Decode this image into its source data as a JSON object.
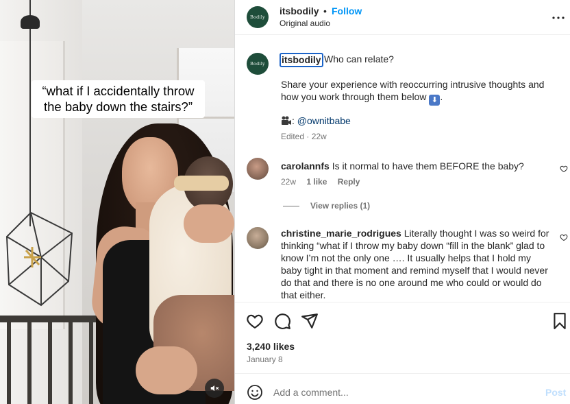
{
  "video": {
    "overlay_caption_line1": "“what if I accidentally throw",
    "overlay_caption_line2": "the baby down the stairs?”",
    "mute_icon": "speaker-muted-icon"
  },
  "header": {
    "avatar_text": "Bodily",
    "username": "itsbodily",
    "dot": "•",
    "follow_label": "Follow",
    "audio_label": "Original audio",
    "more_icon": "more-options-icon"
  },
  "caption": {
    "avatar_text": "Bodily",
    "username": "itsbodily",
    "text_line1": "Who can relate?",
    "text_body": "Share your experience with reoccurring intrusive thoughts and how you work through them below ",
    "text_end": ".",
    "credit_prefix": ":",
    "credit_handle": "@ownitbabe",
    "meta": "Edited · 22w"
  },
  "comments": [
    {
      "username": "carolannfs",
      "text": "Is it normal to have them BEFORE the baby?",
      "age": "22w",
      "likes": "1 like",
      "reply_label": "Reply",
      "view_replies": "View replies (1)"
    },
    {
      "username": "christine_marie_rodrigues",
      "text": "Literally thought I was so weird for thinking “what if I throw my baby down “fill in the blank” glad to know I’m not the only one …. It usually helps that I hold my baby tight in that moment and remind myself that I would never do that and there is no one around me who could or would do that either."
    }
  ],
  "actions": {
    "like_icon": "heart-icon",
    "comment_icon": "comment-icon",
    "share_icon": "share-icon",
    "save_icon": "bookmark-icon",
    "likes_count": "3,240 likes",
    "date": "January 8"
  },
  "comment_bar": {
    "placeholder": "Add a comment...",
    "post_label": "Post",
    "emoji_icon": "emoji-icon"
  },
  "colors": {
    "follow_blue": "#0095f6",
    "link_blue": "#00376b",
    "brand_green": "#1e4d3a",
    "muted_text": "#737373",
    "post_disabled": "#c0dffd"
  }
}
